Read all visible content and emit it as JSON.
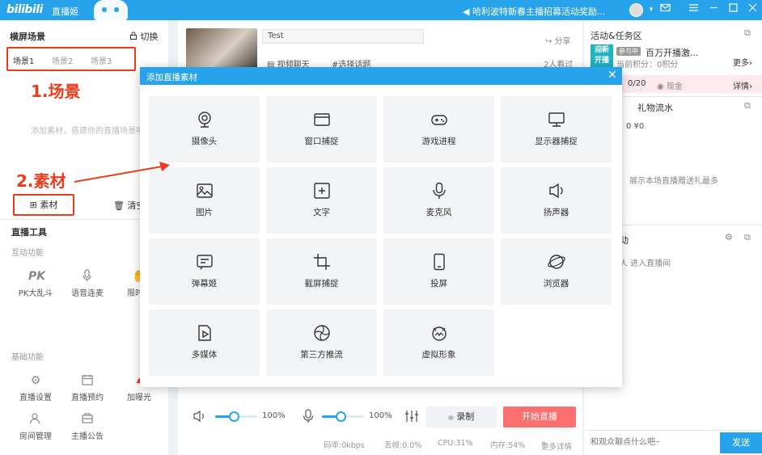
{
  "titlebar": {
    "logo": "bilibili",
    "app_name": "直播姬",
    "announcement": "哈利波特新春主播招募活动奖励..."
  },
  "left": {
    "scene_title": "横屏场景",
    "switch_label": "切换",
    "scenes": [
      "场景1",
      "场景2",
      "场景3"
    ],
    "hint": "添加素材，搭建你的直播场景吧",
    "material_label": "素材",
    "clear_label": "清空",
    "tools_title": "直播工具",
    "interactive_title": "互动功能",
    "interactive": [
      {
        "label": "PK大乱斗",
        "icon": "pk-icon"
      },
      {
        "label": "语音连麦",
        "icon": "voice-link-icon"
      },
      {
        "label": "限时抽",
        "icon": "lottery-icon"
      }
    ],
    "basic_title": "基础功能",
    "basic": [
      {
        "label": "直播设置",
        "icon": "gear-icon"
      },
      {
        "label": "直播预约",
        "icon": "calendar-icon"
      },
      {
        "label": "加曝光",
        "icon": "boost-icon"
      },
      {
        "label": "房间管理",
        "icon": "room-admin-icon"
      },
      {
        "label": "主播公告",
        "icon": "notice-icon"
      }
    ]
  },
  "annotations": {
    "scene": "1.场景",
    "material": "2.素材"
  },
  "center": {
    "stream_title": "Test",
    "share_label": "分享",
    "category": "视频聊天",
    "topic": "#选择话题",
    "viewers": "2人看过"
  },
  "bottom": {
    "speaker_volume": "100%",
    "mic_volume": "100%",
    "speaker_level": 0.45,
    "mic_level": 0.45,
    "record_label": "录制",
    "start_label": "开始直播"
  },
  "status": {
    "bitrate": "码率:0kbps",
    "loss": "丢帧:0.0%",
    "cpu": "CPU:31%",
    "memory": "内存:54%",
    "more": "更多详情"
  },
  "right": {
    "activity_title": "活动&任务区",
    "event_badge": "参与中",
    "event_name": "百万开播激...",
    "event_points": "当前积分：0积分",
    "more_label": "更多",
    "progress": "0/20",
    "cash_label": "现金",
    "detail_label": "详情",
    "gift_title": "礼物流水",
    "gift_stats": "0  ¥0",
    "gift_hint": "展示本场直播赠送礼最多",
    "live_title": "动",
    "enter_text": "人 进入直播间",
    "chat_placeholder": "和观众聊点什么吧~",
    "send_label": "发送"
  },
  "modal": {
    "title": "添加直播素材",
    "items": [
      {
        "label": "摄像头",
        "icon": "camera-icon"
      },
      {
        "label": "窗口捕捉",
        "icon": "window-capture-icon"
      },
      {
        "label": "游戏进程",
        "icon": "gamepad-icon"
      },
      {
        "label": "显示器捕捉",
        "icon": "monitor-icon"
      },
      {
        "label": "图片",
        "icon": "image-icon"
      },
      {
        "label": "文字",
        "icon": "text-icon"
      },
      {
        "label": "麦克风",
        "icon": "microphone-icon"
      },
      {
        "label": "扬声器",
        "icon": "speaker-icon"
      },
      {
        "label": "弹幕姬",
        "icon": "danmaku-icon"
      },
      {
        "label": "截屏捕捉",
        "icon": "crop-icon"
      },
      {
        "label": "投屏",
        "icon": "cast-phone-icon"
      },
      {
        "label": "浏览器",
        "icon": "browser-icon"
      },
      {
        "label": "多媒体",
        "icon": "media-icon"
      },
      {
        "label": "第三方推流",
        "icon": "third-party-stream-icon"
      },
      {
        "label": "虚拟形象",
        "icon": "avatar-icon"
      }
    ]
  },
  "colors": {
    "accent": "#27a3eb",
    "annotation": "#ef3a1c",
    "start_button": "#fb6f6f"
  }
}
